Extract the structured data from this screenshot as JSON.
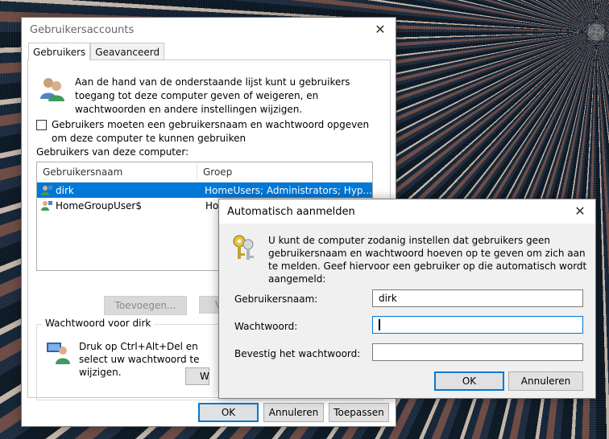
{
  "main_window": {
    "title": "Gebruikersaccounts",
    "tabs": [
      {
        "label": "Gebruikers",
        "active": true
      },
      {
        "label": "Geavanceerd",
        "active": false
      }
    ],
    "intro_text": "Aan de hand van de onderstaande lijst kunt u gebruikers toegang tot deze computer geven of weigeren, en wachtwoorden en andere instellingen wijzigen.",
    "require_login_checkbox": {
      "label": "Gebruikers moeten een gebruikersnaam en wachtwoord opgeven om deze computer te kunnen gebruiken",
      "checked": false
    },
    "users_label": "Gebruikers van deze computer:",
    "columns": [
      "Gebruikersnaam",
      "Groep"
    ],
    "users": [
      {
        "name": "dirk",
        "group": "HomeUsers; Administrators; Hyp...",
        "selected": true
      },
      {
        "name": "HomeGroupUser$",
        "group": "Ho",
        "selected": false
      }
    ],
    "add_button": "Toevoegen...",
    "remove_button_partial": "V",
    "password_group": {
      "title": "Wachtwoord voor dirk",
      "text": "Druk op Ctrl+Alt+Del en select uw wachtwoord te wijzigen.",
      "button_partial": "W"
    },
    "footer": {
      "ok": "OK",
      "cancel": "Annuleren",
      "apply": "Toepassen"
    }
  },
  "dialog": {
    "title": "Automatisch aanmelden",
    "message": "U kunt de computer zodanig instellen dat gebruikers geen gebruikersnaam en wachtwoord hoeven op te geven om zich aan te melden. Geef hiervoor een gebruiker op die automatisch wordt aangemeld:",
    "fields": {
      "username_label": "Gebruikersnaam:",
      "username_value": "dirk",
      "password_label": "Wachtwoord:",
      "password_value": "",
      "confirm_label": "Bevestig het wachtwoord:",
      "confirm_value": ""
    },
    "ok": "OK",
    "cancel": "Annuleren"
  },
  "colors": {
    "selection": "#0078d7",
    "focus": "#0078d7"
  }
}
